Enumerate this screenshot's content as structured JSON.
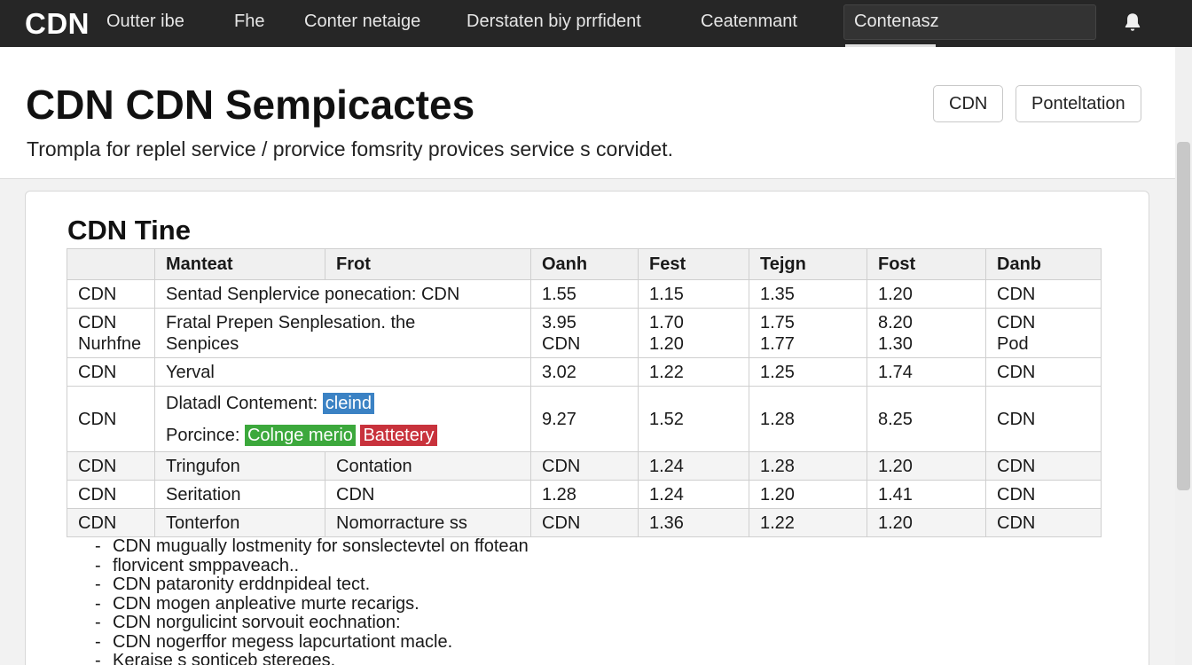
{
  "nav": {
    "brand": "CDN",
    "links": [
      "Outter ibe",
      "Fhe",
      "Conter netaige",
      "Derstaten biy prrfident",
      "Ceatenmant"
    ],
    "search_value": "Contenasz",
    "bell_icon": "bell-icon"
  },
  "header": {
    "title": "CDN CDN Sempicactes",
    "subtitle": "Trompla for replel service  / prorvice fomsrity provices service s corvidet.",
    "buttons": [
      "CDN",
      "Ponteltation"
    ]
  },
  "card": {
    "title": "CDN Tine",
    "columns": [
      "",
      "Manteat",
      "Frot",
      "Oanh",
      "Fest",
      "Tejgn",
      "Fost",
      "Danb"
    ],
    "rows": [
      {
        "c0": "CDN",
        "c1": "Sentad Senplervice ponecation: CDN",
        "c3": "1.55",
        "c4": "1.15",
        "c5": "1.35",
        "c6": "1.20",
        "c7": "CDN"
      },
      {
        "c0a": "CDN",
        "c0b": "Nurhfne",
        "c1a": "Fratal Prepen Senplesation. the",
        "c1b": "Senpices",
        "c3a": "3.95",
        "c3b": "CDN",
        "c4a": "1.70",
        "c4b": "1.20",
        "c5a": "1.75",
        "c5b": "1.77",
        "c6a": "8.20",
        "c6b": "1.30",
        "c7a": "CDN",
        "c7b": "Pod"
      },
      {
        "c0": "CDN",
        "c1": "Yerval",
        "c3": "3.02",
        "c4": "1.22",
        "c5": "1.25",
        "c6": "1.74",
        "c7": "CDN"
      },
      {
        "c0": "CDN",
        "c1a_label": "Dlatadl Contement:",
        "c1a_tag": "cleind",
        "c1b_label": "Porcince:",
        "c1b_tag1": "Colnge merio",
        "c1b_tag2": "Battetery",
        "c3": "9.27",
        "c4": "1.52",
        "c5": "1.28",
        "c6": "8.25",
        "c7": "CDN"
      },
      {
        "c0": "CDN",
        "c1": "Tringufon",
        "c2": "Contation",
        "c3": "CDN",
        "c4": "1.24",
        "c5": "1.28",
        "c6": "1.20",
        "c7": "CDN"
      },
      {
        "c0": "CDN",
        "c1": "Seritation",
        "c2": "CDN",
        "c3": "1.28",
        "c4": "1.24",
        "c5": "1.20",
        "c6": "1.41",
        "c7": "CDN"
      },
      {
        "c0": "CDN",
        "c1": "Tonterfon",
        "c2": "Nomorracture ss",
        "c3": "CDN",
        "c4": "1.36",
        "c5": "1.22",
        "c6": "1.20",
        "c7": "CDN"
      }
    ],
    "notes": [
      "CDN mugually lostmenity for sonslectevtel on ffotean",
      "florvicent smppaveach..",
      "CDN pataronity erddnpideal tect.",
      "CDN mogen anpleative murte recarigs.",
      "CDN norgulicint sorvouit eochnation:",
      "CDN nogerffor megess lapcurtationt macle.",
      "Keraise s sonticeb stereges."
    ]
  },
  "colors": {
    "nav_bg": "#262626",
    "tag_blue": "#3b82c4",
    "tag_green": "#3ca83c",
    "tag_red": "#c8323c"
  }
}
